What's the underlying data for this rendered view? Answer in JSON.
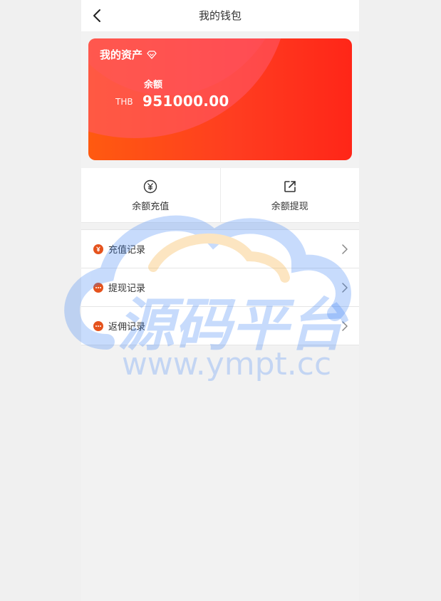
{
  "header": {
    "title": "我的钱包"
  },
  "card": {
    "title": "我的资产",
    "balance_label": "余额",
    "currency": "THB",
    "amount": "951000.00"
  },
  "actions": [
    {
      "label": "余额充值",
      "icon": "yen-circle-icon"
    },
    {
      "label": "余额提现",
      "icon": "external-link-icon"
    }
  ],
  "records": [
    {
      "label": "充值记录",
      "icon": "yen-badge-icon"
    },
    {
      "label": "提现记录",
      "icon": "dots-badge-icon"
    },
    {
      "label": "返佣记录",
      "icon": "dots-badge-icon"
    }
  ],
  "watermark": {
    "title": "源码平台",
    "url": "www.ympt.cc"
  },
  "colors": {
    "card_start": "#ff5a10",
    "card_end": "#ff2618",
    "badge": "#e5531d",
    "page_bg": "#f2f2f2"
  }
}
